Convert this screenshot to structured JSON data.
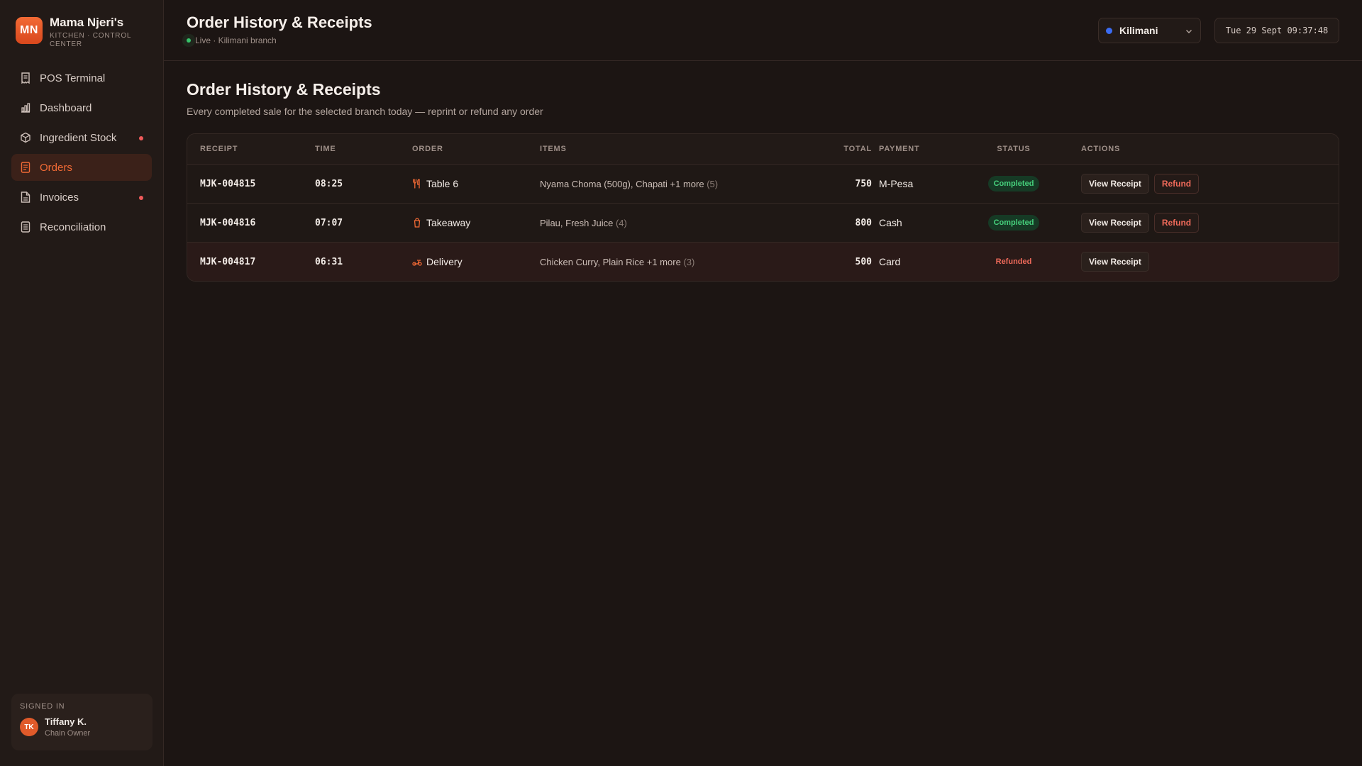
{
  "brand": {
    "initials": "MN",
    "name": "Mama Njeri's",
    "subtitle": "KITCHEN · CONTROL CENTER"
  },
  "nav": [
    {
      "label": "POS Terminal",
      "icon": "receipt-icon",
      "active": false,
      "dot": false
    },
    {
      "label": "Dashboard",
      "icon": "bar-chart-icon",
      "active": false,
      "dot": false
    },
    {
      "label": "Ingredient Stock",
      "icon": "box-icon",
      "active": false,
      "dot": true
    },
    {
      "label": "Orders",
      "icon": "document-icon",
      "active": true,
      "dot": false
    },
    {
      "label": "Invoices",
      "icon": "invoice-icon",
      "active": false,
      "dot": true
    },
    {
      "label": "Reconciliation",
      "icon": "ledger-icon",
      "active": false,
      "dot": false
    }
  ],
  "user": {
    "label": "SIGNED IN",
    "initials": "TK",
    "name": "Tiffany K.",
    "role": "Chain Owner"
  },
  "topbar": {
    "title": "Order History & Receipts",
    "status": "Live · Kilimani branch",
    "branch": "Kilimani",
    "datetime": "Tue 29 Sept 09:37:48"
  },
  "page": {
    "title": "Order History & Receipts",
    "subtitle": "Every completed sale for the selected branch today — reprint or refund any order"
  },
  "table": {
    "columns": {
      "receipt": "RECEIPT",
      "time": "TIME",
      "order": "ORDER",
      "items": "ITEMS",
      "total": "TOTAL",
      "payment": "PAYMENT",
      "status": "STATUS",
      "actions": "ACTIONS"
    },
    "rows": [
      {
        "receipt": "MJK-004815",
        "time": "08:25",
        "order": "Table 6",
        "order_icon": "utensils-icon",
        "items": "Nyama Choma (500g), Chapati +1 more",
        "items_count": "(5)",
        "total": "750",
        "payment": "M-Pesa",
        "status": "Completed",
        "actions": [
          "View Receipt",
          "Refund"
        ]
      },
      {
        "receipt": "MJK-004816",
        "time": "07:07",
        "order": "Takeaway",
        "order_icon": "takeaway-cup-icon",
        "items": "Pilau, Fresh Juice",
        "items_count": "(4)",
        "total": "800",
        "payment": "Cash",
        "status": "Completed",
        "actions": [
          "View Receipt",
          "Refund"
        ]
      },
      {
        "receipt": "MJK-004817",
        "time": "06:31",
        "order": "Delivery",
        "order_icon": "scooter-icon",
        "items": "Chicken Curry, Plain Rice +1 more",
        "items_count": "(3)",
        "total": "500",
        "payment": "Card",
        "status": "Refunded",
        "actions": [
          "View Receipt"
        ]
      }
    ]
  },
  "colors": {
    "accent": "#f26a35",
    "success": "#46d07c",
    "danger": "#ef6a5a",
    "branch_dot": "#3b6cf2"
  }
}
